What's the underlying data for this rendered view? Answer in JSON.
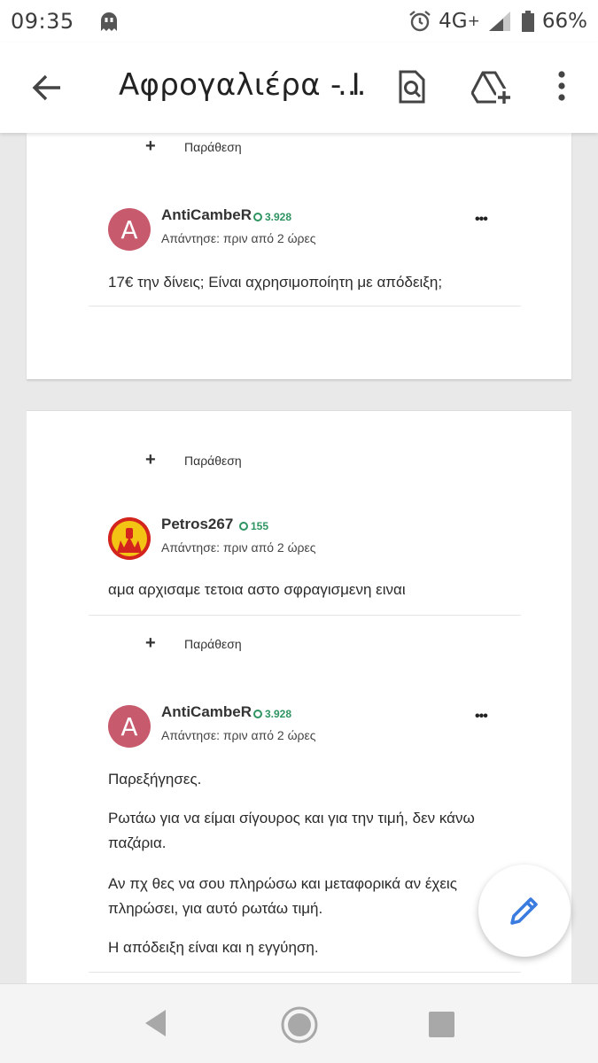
{
  "status_bar": {
    "time": "09:35",
    "network": "4G",
    "network_plus": "+",
    "battery": "66%",
    "icons": [
      "ghost-icon",
      "alarm-icon",
      "signal-icon",
      "battery-icon"
    ]
  },
  "app_bar": {
    "title": "Αφρογαλιέρα - Ι",
    "title_ellipsis": "...",
    "icons": [
      "back-arrow-icon",
      "find-in-page-icon",
      "drive-add-icon",
      "more-vert-icon"
    ]
  },
  "quote_label": "Παράθεση",
  "posts": [
    {
      "avatar_letter": "A",
      "username": "AntiCambeR",
      "reputation": "3.928",
      "meta": "Απάντησε: πριν από 2 ώρες",
      "more": "•••",
      "paragraphs": [
        "17€ την δίνεις; Είναι αχρησιμοποίητη με απόδειξη;"
      ]
    },
    {
      "avatar_letter": "",
      "username": "Petros267",
      "reputation": "155",
      "meta": "Απάντησε: πριν από 2 ώρες",
      "paragraphs": [
        "αμα αρχισαμε τετοια αστο σφραγισμενη ειναι"
      ]
    },
    {
      "avatar_letter": "A",
      "username": "AntiCambeR",
      "reputation": "3.928",
      "meta": "Απάντησε: πριν από 2 ώρες",
      "more": "•••",
      "paragraphs": [
        "Παρεξήγησες.",
        "Ρωτάω για να είμαι σίγουρος και για την τιμή, δεν κάνω παζάρια.",
        "Αν πχ θες να σου πληρώσω και μεταφορικά αν έχεις πληρώσει, για αυτό ρωτάω τιμή.",
        "Η απόδειξη είναι και η εγγύηση."
      ]
    }
  ],
  "fab_icon": "pencil-icon",
  "colors": {
    "avatar": "#c75a6c",
    "reputation": "#2e9461",
    "fab_icon": "#3a7be0"
  }
}
